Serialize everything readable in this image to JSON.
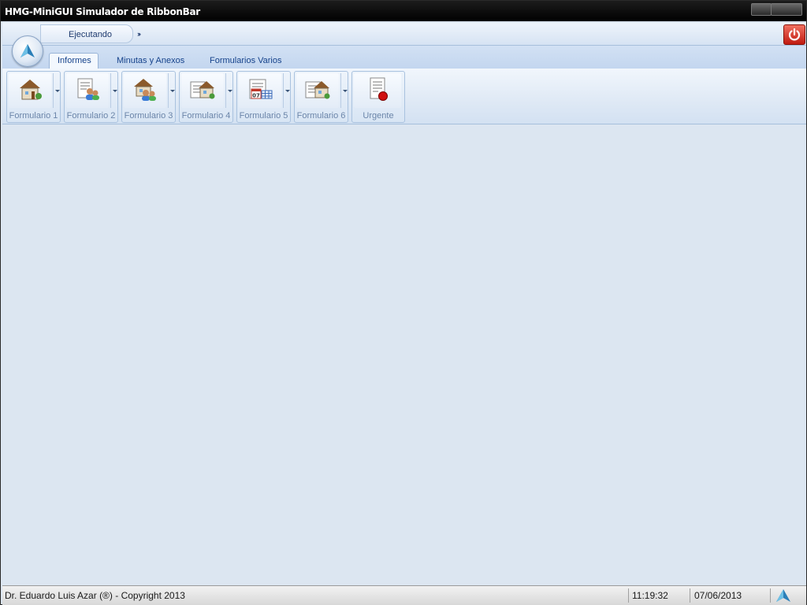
{
  "window": {
    "title": "HMG-MiniGUI Simulador de RibbonBar"
  },
  "quick_access": {
    "label": "Ejecutando",
    "more": "›››"
  },
  "tabs": [
    {
      "label": "Informes",
      "active": true
    },
    {
      "label": "Minutas y Anexos",
      "active": false
    },
    {
      "label": "Formularios Varios",
      "active": false
    }
  ],
  "ribbon": {
    "buttons": [
      {
        "label": "Formulario 1",
        "icon": "house-icon",
        "has_dropdown": true
      },
      {
        "label": "Formulario 2",
        "icon": "users-document-icon",
        "has_dropdown": true
      },
      {
        "label": "Formulario 3",
        "icon": "house-users-icon",
        "has_dropdown": true
      },
      {
        "label": "Formulario 4",
        "icon": "house-document-icon",
        "has_dropdown": true
      },
      {
        "label": "Formulario 5",
        "icon": "calendar-document-icon",
        "has_dropdown": true
      },
      {
        "label": "Formulario 6",
        "icon": "house-document-icon",
        "has_dropdown": true
      },
      {
        "label": "Urgente",
        "icon": "urgent-document-icon",
        "has_dropdown": false
      }
    ],
    "calendar_day": "07"
  },
  "statusbar": {
    "copyright": "Dr. Eduardo Luis Azar (®) - Copyright 2013",
    "time": "11:19:32",
    "date": "07/06/2013"
  },
  "colors": {
    "accent": "#15428b",
    "power": "#d0281a",
    "background": "#dce6f1"
  }
}
